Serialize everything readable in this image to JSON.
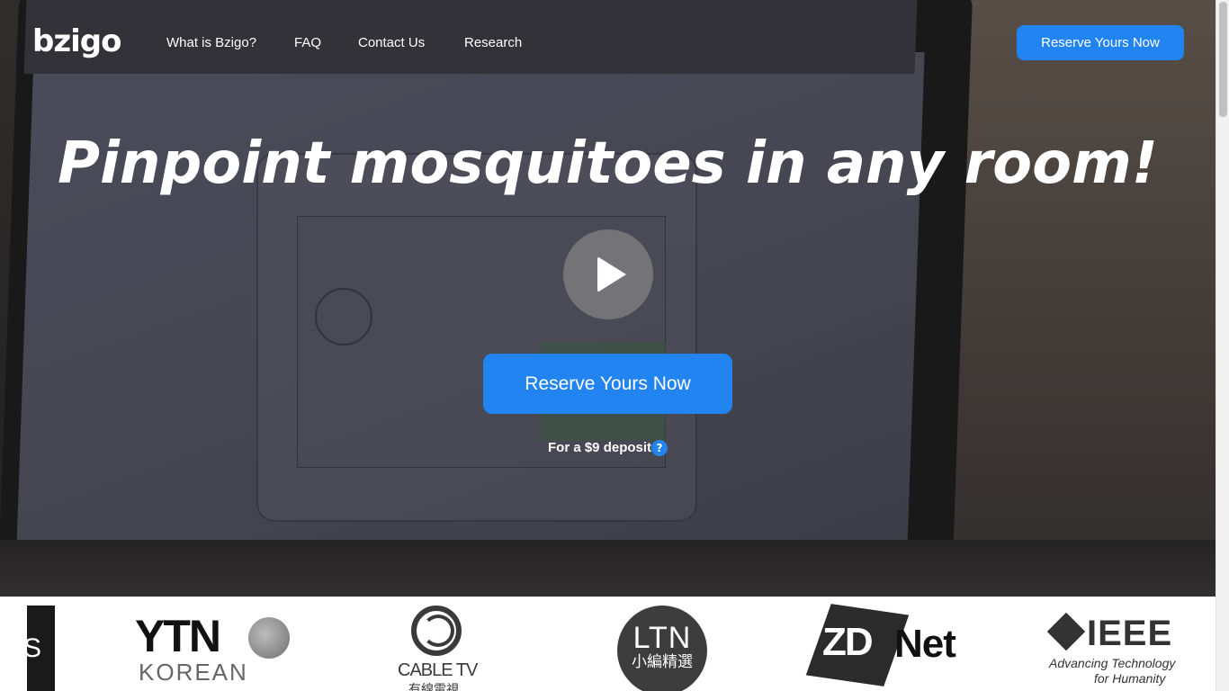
{
  "brand": {
    "logo_text": "bzigo"
  },
  "nav": {
    "items": [
      {
        "label": "What is Bzigo?"
      },
      {
        "label": "FAQ"
      },
      {
        "label": "Contact Us"
      },
      {
        "label": "Research"
      }
    ],
    "cta_label": "Reserve Yours Now"
  },
  "hero": {
    "headline": "Pinpoint mosquitoes in any room!",
    "play_icon": "play-icon",
    "cta_label": "Reserve Yours Now",
    "deposit_text": "For a $9 deposit",
    "help_symbol": "?"
  },
  "press": {
    "partial_logo_text": "S",
    "ytn": {
      "main": "YTN",
      "sub": "KOREAN"
    },
    "cable_tv": {
      "main": "CABLE TV",
      "sub": "有線電視"
    },
    "ltn": {
      "main": "LTN",
      "sub": "小編精選"
    },
    "zdnet": {
      "zd": "ZD",
      "net": "Net"
    },
    "ieee": {
      "main": "IEEE",
      "tagline_line1": "Advancing Technology",
      "tagline_line2": "for Humanity"
    }
  },
  "colors": {
    "accent": "#2284f0",
    "hero_dark": "#2a2727",
    "text_light": "#ffffff"
  }
}
